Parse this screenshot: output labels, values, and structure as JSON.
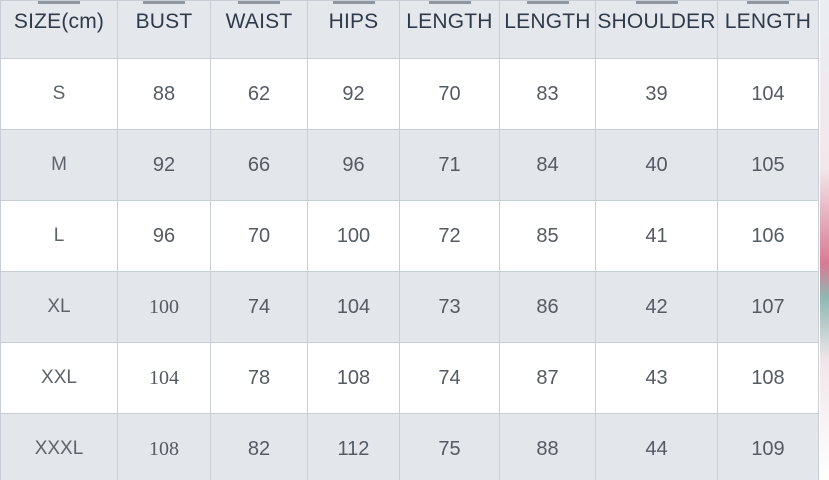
{
  "table": {
    "headers": [
      "SIZE(cm)",
      "BUST",
      "WAIST",
      "HIPS",
      "LENGTH",
      "LENGTH",
      "SHOULDER",
      "LENGTH"
    ],
    "rows": [
      [
        "S",
        "88",
        "62",
        "92",
        "70",
        "83",
        "39",
        "104"
      ],
      [
        "M",
        "92",
        "66",
        "96",
        "71",
        "84",
        "40",
        "105"
      ],
      [
        "L",
        "96",
        "70",
        "100",
        "72",
        "85",
        "41",
        "106"
      ],
      [
        "XL",
        "100",
        "74",
        "104",
        "73",
        "86",
        "42",
        "107"
      ],
      [
        "XXL",
        "104",
        "78",
        "108",
        "74",
        "87",
        "43",
        "108"
      ],
      [
        "XXXL",
        "108",
        "82",
        "112",
        "75",
        "88",
        "44",
        "109"
      ]
    ]
  },
  "colors": {
    "header_bg": "#e4e7eb",
    "alt_row_bg": "#e3e6ea",
    "row_bg": "#ffffff",
    "grid": "#c9ced6",
    "header_text": "#2f3b4a",
    "cell_text": "#555b63"
  }
}
